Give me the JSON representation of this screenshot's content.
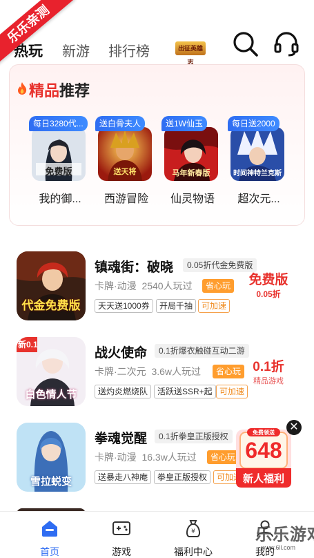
{
  "ribbon": "乐乐亲测",
  "top_tabs": [
    {
      "label": "热玩",
      "active": true
    },
    {
      "label": "新游",
      "active": false
    },
    {
      "label": "排行榜",
      "active": false
    }
  ],
  "top_logo_text": "出征英雄志",
  "icons": {
    "search": "search-icon",
    "support": "headset-icon",
    "fire": "fire-icon",
    "close": "close-icon"
  },
  "recommend": {
    "title_highlight": "精品",
    "title_rest": "推荐",
    "items": [
      {
        "badge": "每日3280代...",
        "name": "我的御...",
        "cover_text": "免费版"
      },
      {
        "badge": "送白骨夫人",
        "name": "西游冒险",
        "cover_text": "送天将"
      },
      {
        "badge": "送1W仙玉",
        "name": "仙灵物语",
        "cover_text": "马年新春版"
      },
      {
        "badge": "每日送2000",
        "name": "超次元...",
        "cover_text": "时间神特兰克斯"
      }
    ]
  },
  "games": [
    {
      "title": "镇魂街：破晓",
      "tag": "0.05折代金免费版",
      "meta": "卡牌·动漫",
      "players": "2540人玩过",
      "save": "省心玩",
      "chips": [
        "天天送1000券",
        "开局千抽",
        "可加速"
      ],
      "badge_big": "免费版",
      "badge_small": "0.05折",
      "badge_sub": "",
      "cover_text": "代金免费版"
    },
    {
      "title": "战火使命",
      "tag": "0.1折爆衣触碰互动二游",
      "meta": "卡牌·二次元",
      "players": "3.6w人玩过",
      "save": "省心玩",
      "chips": [
        "送灼炎燃烧队",
        "活跃送SSR+起",
        "可加速"
      ],
      "badge_big": "0.1折",
      "badge_small": "",
      "badge_sub": "精品游戏",
      "cover_text": "白色情人节"
    },
    {
      "title": "拳魂觉醒",
      "tag": "0.1折拳皇正版授权",
      "meta": "卡牌·动漫",
      "players": "16.3w人玩过",
      "save": "省心玩",
      "chips": [
        "送暴走八神庵",
        "拳皇正版授权",
        "可加速"
      ],
      "badge_big": "",
      "badge_small": "",
      "badge_sub": "",
      "cover_text": "雪拉蜕变"
    }
  ],
  "packet": {
    "top": "免费领送",
    "amount": "648",
    "label": "新人福利"
  },
  "bottom_nav": [
    {
      "label": "首页",
      "active": true,
      "icon": "home-icon"
    },
    {
      "label": "游戏",
      "active": false,
      "icon": "gamepad-icon"
    },
    {
      "label": "福利中心",
      "active": false,
      "icon": "money-bag-icon"
    },
    {
      "label": "我的",
      "active": false,
      "icon": "profile-icon"
    }
  ],
  "watermark": {
    "text": "乐乐游戏",
    "url": "www.6ll.com"
  },
  "colors": {
    "accent_blue": "#2f6df2",
    "accent_red": "#e8322d",
    "save_orange": "#ff9d2e"
  }
}
